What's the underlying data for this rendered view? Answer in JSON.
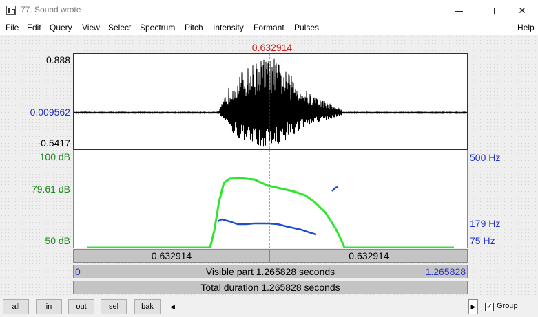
{
  "window": {
    "title": "77. Sound wrote"
  },
  "menu": [
    "File",
    "Edit",
    "Query",
    "View",
    "Select",
    "Spectrum",
    "Pitch",
    "Intensity",
    "Formant",
    "Pulses"
  ],
  "help_label": "Help",
  "cursor_time": "0.632914",
  "sound": {
    "max_label": "0.888",
    "center_label": "0.009562",
    "min_label": "-0.5417"
  },
  "intensity_scale": {
    "top": "100 dB",
    "mid": "79.61 dB",
    "bottom": "50 dB"
  },
  "pitch_scale": {
    "top": "500 Hz",
    "mid": "179 Hz",
    "bottom": "75 Hz"
  },
  "time_bars": {
    "left_time": "0.632914",
    "right_time": "0.632914",
    "visible_start": "0",
    "visible_end": "1.265828",
    "visible_text": "Visible part 1.265828 seconds",
    "total_text": "Total duration 1.265828 seconds"
  },
  "buttons": {
    "all": "all",
    "in": "in",
    "out": "out",
    "sel": "sel",
    "bak": "bak"
  },
  "group": {
    "label": "Group",
    "checked": true,
    "check_mark": "✓"
  },
  "colors": {
    "intensity": "#2ee62e",
    "pitch": "#1a4fd1",
    "cursor": "#cc1f1f",
    "waveform": "#000000"
  },
  "icons": {
    "scroll_left": "◀",
    "scroll_right": "▶",
    "minimize": "minimize-icon",
    "maximize": "maximize-icon",
    "close": "✕"
  }
}
